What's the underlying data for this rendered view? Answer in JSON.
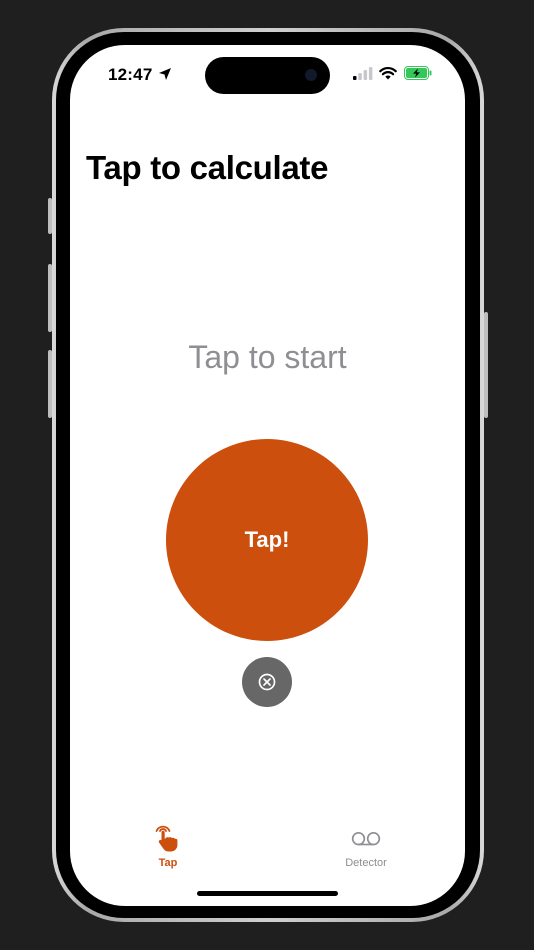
{
  "status_bar": {
    "time": "12:47",
    "icons": [
      "location-arrow-icon",
      "cellular-signal-icon",
      "wifi-icon",
      "battery-charging-icon"
    ]
  },
  "header": {
    "title": "Tap to calculate"
  },
  "main": {
    "prompt": "Tap to start",
    "tap_button_label": "Tap!",
    "reset_button_icon": "close-circle-icon"
  },
  "tab_bar": {
    "items": [
      {
        "label": "Tap",
        "icon": "tap-hand-icon",
        "active": true
      },
      {
        "label": "Detector",
        "icon": "voicemail-icon",
        "active": false
      }
    ]
  },
  "colors": {
    "accent": "#cd4f0e",
    "secondary_text": "#8e8e93",
    "reset_button": "#676767",
    "battery_fill": "#34c759"
  }
}
